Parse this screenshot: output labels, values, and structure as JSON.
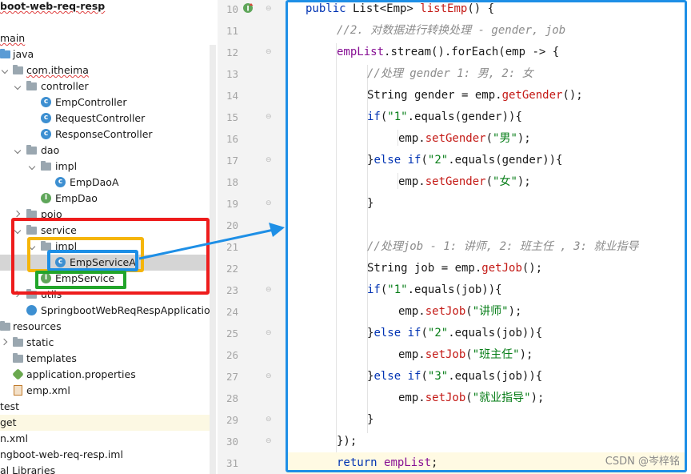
{
  "project_tree": {
    "title": "boot-web-req-resp",
    "items": [
      {
        "label": "main"
      },
      {
        "label": "java"
      },
      {
        "label": "com.itheima"
      },
      {
        "label": "controller"
      },
      {
        "label": "EmpController"
      },
      {
        "label": "RequestController"
      },
      {
        "label": "ResponseController"
      },
      {
        "label": "dao"
      },
      {
        "label": "impl"
      },
      {
        "label": "EmpDaoA"
      },
      {
        "label": "EmpDao"
      },
      {
        "label": "pojo"
      },
      {
        "label": "service"
      },
      {
        "label": "impl"
      },
      {
        "label": "EmpServiceA"
      },
      {
        "label": "EmpService"
      },
      {
        "label": "utils"
      },
      {
        "label": "SpringbootWebReqRespApplication"
      },
      {
        "label": "resources"
      },
      {
        "label": "static"
      },
      {
        "label": "templates"
      },
      {
        "label": "application.properties"
      },
      {
        "label": "emp.xml"
      },
      {
        "label": "test"
      },
      {
        "label": "get"
      },
      {
        "label": "n.xml"
      },
      {
        "label": "ngboot-web-req-resp.iml"
      },
      {
        "label": "al Libraries"
      }
    ]
  },
  "editor": {
    "line_numbers": [
      "10",
      "11",
      "12",
      "13",
      "14",
      "15",
      "16",
      "17",
      "18",
      "19",
      "20",
      "21",
      "22",
      "23",
      "24",
      "25",
      "26",
      "27",
      "28",
      "29",
      "30",
      "31"
    ],
    "lines": [
      "public List<Emp> listEmp() {",
      "//2. 对数据进行转换处理 - gender, job",
      "empList.stream().forEach(emp -> {",
      "//处理 gender 1: 男, 2: 女",
      "String gender = emp.getGender();",
      "if(\"1\".equals(gender)){",
      "emp.setGender(\"男\");",
      "}else if(\"2\".equals(gender)){",
      "emp.setGender(\"女\");",
      "}",
      "",
      "//处理job - 1: 讲师, 2: 班主任 , 3: 就业指导",
      "String job = emp.getJob();",
      "if(\"1\".equals(job)){",
      "emp.setJob(\"讲师\");",
      "}else if(\"2\".equals(job)){",
      "emp.setJob(\"班主任\");",
      "}else if(\"3\".equals(job)){",
      "emp.setJob(\"就业指导\");",
      "}",
      "});",
      "return empList;"
    ]
  },
  "watermark": "CSDN @岑梓铭",
  "colors": {
    "red_box": "#ee1c1c",
    "yellow_box": "#f5b50a",
    "blue_box": "#1e8fe6",
    "green_box": "#22a52a",
    "arrow": "#1e8fe6"
  }
}
